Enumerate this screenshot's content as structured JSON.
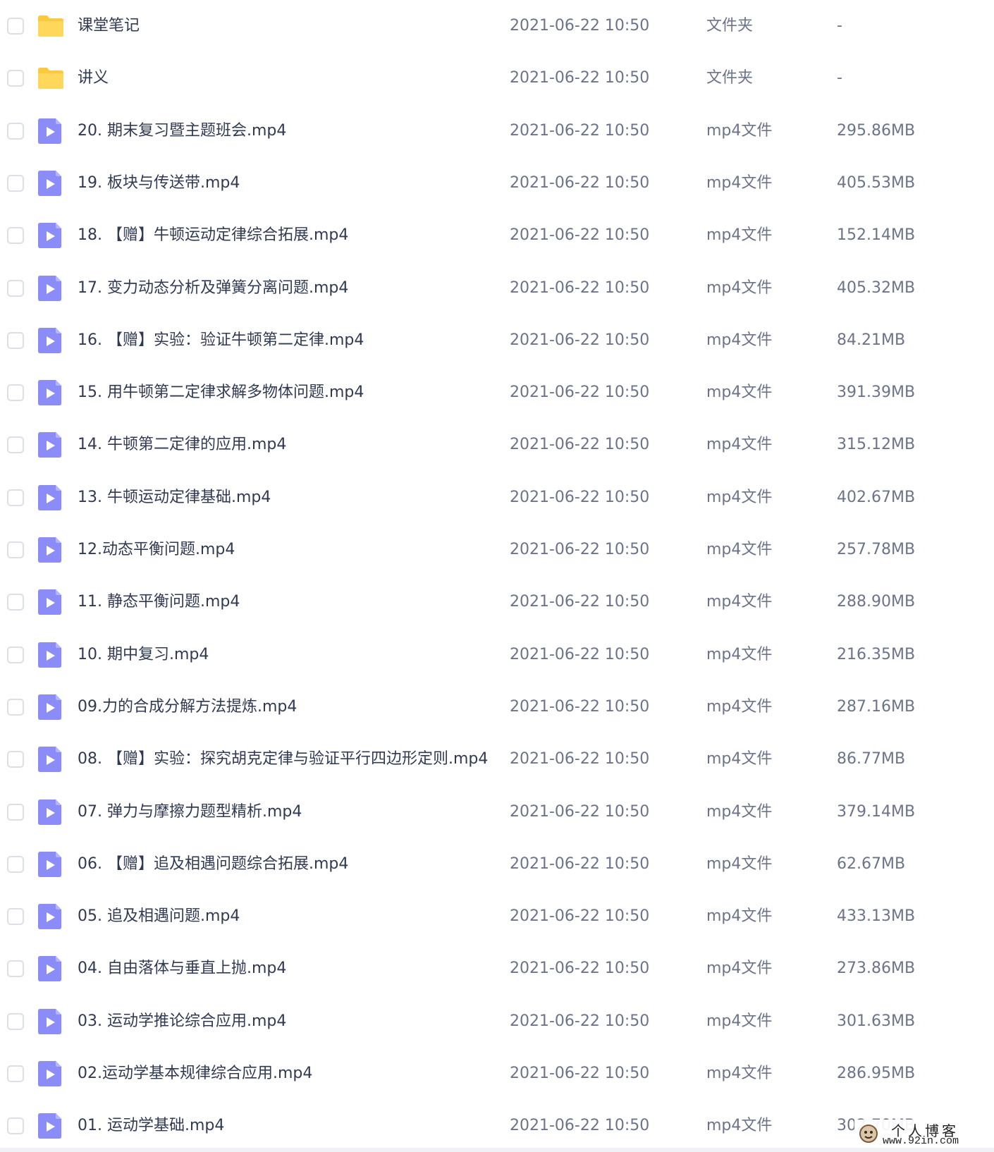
{
  "colors": {
    "folder": "#fcc93e",
    "video": "#8b8cf8",
    "checkbox_border": "#dcdfe6"
  },
  "rows": [
    {
      "name": "课堂笔记",
      "date": "2021-06-22 10:50",
      "type": "文件夹",
      "size": "-",
      "icon": "folder-icon"
    },
    {
      "name": "讲义",
      "date": "2021-06-22 10:50",
      "type": "文件夹",
      "size": "-",
      "icon": "folder-icon"
    },
    {
      "name": "20. 期末复习暨主题班会.mp4",
      "date": "2021-06-22 10:50",
      "type": "mp4文件",
      "size": "295.86MB",
      "icon": "video-file-icon"
    },
    {
      "name": "19. 板块与传送带.mp4",
      "date": "2021-06-22 10:50",
      "type": "mp4文件",
      "size": "405.53MB",
      "icon": "video-file-icon"
    },
    {
      "name": "18. 【赠】牛顿运动定律综合拓展.mp4",
      "date": "2021-06-22 10:50",
      "type": "mp4文件",
      "size": "152.14MB",
      "icon": "video-file-icon"
    },
    {
      "name": "17. 变力动态分析及弹簧分离问题.mp4",
      "date": "2021-06-22 10:50",
      "type": "mp4文件",
      "size": "405.32MB",
      "icon": "video-file-icon"
    },
    {
      "name": "16. 【赠】实验：验证牛顿第二定律.mp4",
      "date": "2021-06-22 10:50",
      "type": "mp4文件",
      "size": "84.21MB",
      "icon": "video-file-icon"
    },
    {
      "name": "15. 用牛顿第二定律求解多物体问题.mp4",
      "date": "2021-06-22 10:50",
      "type": "mp4文件",
      "size": "391.39MB",
      "icon": "video-file-icon"
    },
    {
      "name": "14. 牛顿第二定律的应用.mp4",
      "date": "2021-06-22 10:50",
      "type": "mp4文件",
      "size": "315.12MB",
      "icon": "video-file-icon"
    },
    {
      "name": "13. 牛顿运动定律基础.mp4",
      "date": "2021-06-22 10:50",
      "type": "mp4文件",
      "size": "402.67MB",
      "icon": "video-file-icon"
    },
    {
      "name": "12.动态平衡问题.mp4",
      "date": "2021-06-22 10:50",
      "type": "mp4文件",
      "size": "257.78MB",
      "icon": "video-file-icon"
    },
    {
      "name": "11. 静态平衡问题.mp4",
      "date": "2021-06-22 10:50",
      "type": "mp4文件",
      "size": "288.90MB",
      "icon": "video-file-icon"
    },
    {
      "name": "10. 期中复习.mp4",
      "date": "2021-06-22 10:50",
      "type": "mp4文件",
      "size": "216.35MB",
      "icon": "video-file-icon"
    },
    {
      "name": "09.力的合成分解方法提炼.mp4",
      "date": "2021-06-22 10:50",
      "type": "mp4文件",
      "size": "287.16MB",
      "icon": "video-file-icon"
    },
    {
      "name": "08. 【赠】实验：探究胡克定律与验证平行四边形定则.mp4",
      "date": "2021-06-22 10:50",
      "type": "mp4文件",
      "size": "86.77MB",
      "icon": "video-file-icon"
    },
    {
      "name": "07. 弹力与摩擦力题型精析.mp4",
      "date": "2021-06-22 10:50",
      "type": "mp4文件",
      "size": "379.14MB",
      "icon": "video-file-icon"
    },
    {
      "name": "06. 【赠】追及相遇问题综合拓展.mp4",
      "date": "2021-06-22 10:50",
      "type": "mp4文件",
      "size": "62.67MB",
      "icon": "video-file-icon"
    },
    {
      "name": "05. 追及相遇问题.mp4",
      "date": "2021-06-22 10:50",
      "type": "mp4文件",
      "size": "433.13MB",
      "icon": "video-file-icon"
    },
    {
      "name": "04. 自由落体与垂直上抛.mp4",
      "date": "2021-06-22 10:50",
      "type": "mp4文件",
      "size": "273.86MB",
      "icon": "video-file-icon"
    },
    {
      "name": "03. 运动学推论综合应用.mp4",
      "date": "2021-06-22 10:50",
      "type": "mp4文件",
      "size": "301.63MB",
      "icon": "video-file-icon"
    },
    {
      "name": "02.运动学基本规律综合应用.mp4",
      "date": "2021-06-22 10:50",
      "type": "mp4文件",
      "size": "286.95MB",
      "icon": "video-file-icon"
    },
    {
      "name": "01. 运动学基础.mp4",
      "date": "2021-06-22 10:50",
      "type": "mp4文件",
      "size": "302.70MB",
      "icon": "video-file-icon"
    }
  ],
  "watermark": {
    "title": "个人博客",
    "url": "www.92in.com"
  }
}
